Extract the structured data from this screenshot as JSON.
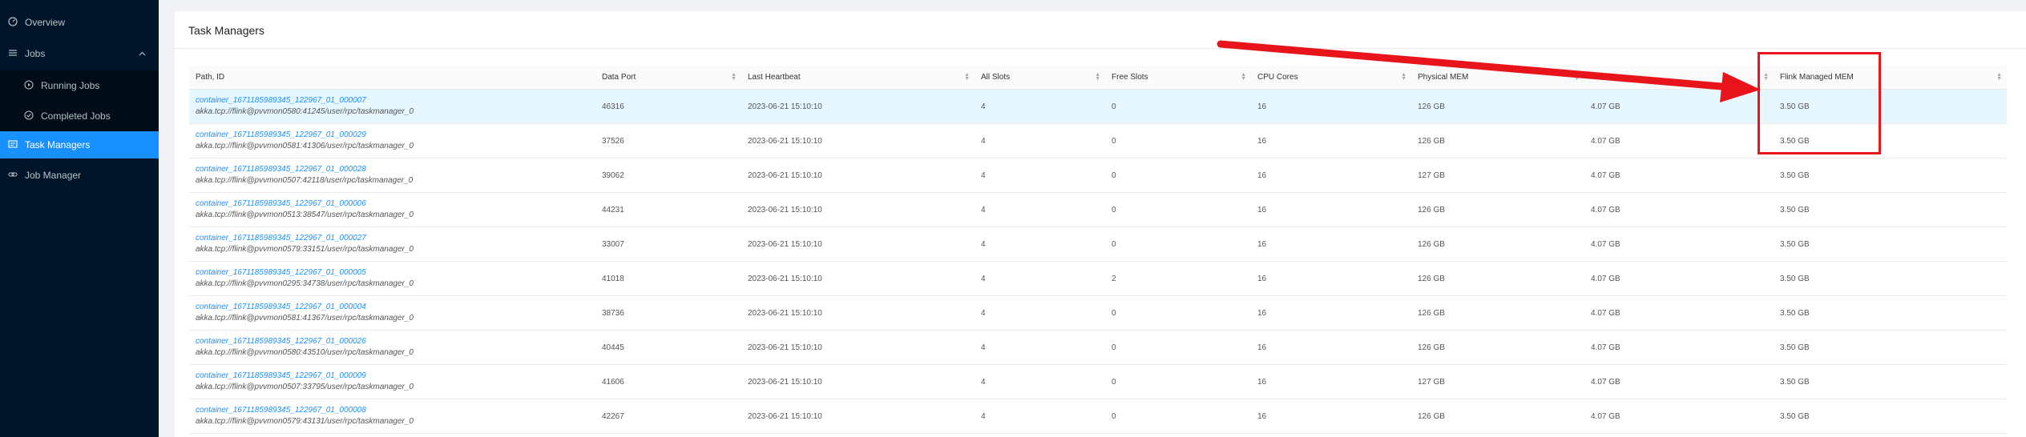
{
  "sidebar": {
    "overview": "Overview",
    "jobs": "Jobs",
    "running_jobs": "Running Jobs",
    "completed_jobs": "Completed Jobs",
    "task_managers": "Task Managers",
    "job_manager": "Job Manager"
  },
  "panel": {
    "title": "Task Managers"
  },
  "table": {
    "headers": [
      "Path, ID",
      "Data Port",
      "Last Heartbeat",
      "All Slots",
      "Free Slots",
      "CPU Cores",
      "Physical MEM",
      "",
      "Flink Managed MEM"
    ],
    "rows": [
      {
        "id": "container_1671185989345_122967_01_000007",
        "path": "akka.tcp://flink@pvvmon0580:41245/user/rpc/taskmanager_0",
        "port": "46316",
        "hb": "2023-06-21 15:10:10",
        "all": "4",
        "free": "0",
        "cores": "16",
        "phys": "126 GB",
        "jvm": "4.07 GB",
        "managed": "3.50 GB"
      },
      {
        "id": "container_1671185989345_122967_01_000029",
        "path": "akka.tcp://flink@pvvmon0581:41306/user/rpc/taskmanager_0",
        "port": "37526",
        "hb": "2023-06-21 15:10:10",
        "all": "4",
        "free": "0",
        "cores": "16",
        "phys": "126 GB",
        "jvm": "4.07 GB",
        "managed": "3.50 GB"
      },
      {
        "id": "container_1671185989345_122967_01_000028",
        "path": "akka.tcp://flink@pvvmon0507:42118/user/rpc/taskmanager_0",
        "port": "39062",
        "hb": "2023-06-21 15:10:10",
        "all": "4",
        "free": "0",
        "cores": "16",
        "phys": "127 GB",
        "jvm": "4.07 GB",
        "managed": "3.50 GB"
      },
      {
        "id": "container_1671185989345_122967_01_000006",
        "path": "akka.tcp://flink@pvvmon0513:38547/user/rpc/taskmanager_0",
        "port": "44231",
        "hb": "2023-06-21 15:10:10",
        "all": "4",
        "free": "0",
        "cores": "16",
        "phys": "126 GB",
        "jvm": "4.07 GB",
        "managed": "3.50 GB"
      },
      {
        "id": "container_1671185989345_122967_01_000027",
        "path": "akka.tcp://flink@pvvmon0579:33151/user/rpc/taskmanager_0",
        "port": "33007",
        "hb": "2023-06-21 15:10:10",
        "all": "4",
        "free": "0",
        "cores": "16",
        "phys": "126 GB",
        "jvm": "4.07 GB",
        "managed": "3.50 GB"
      },
      {
        "id": "container_1671185989345_122967_01_000005",
        "path": "akka.tcp://flink@pvvmon0295:34738/user/rpc/taskmanager_0",
        "port": "41018",
        "hb": "2023-06-21 15:10:10",
        "all": "4",
        "free": "2",
        "cores": "16",
        "phys": "126 GB",
        "jvm": "4.07 GB",
        "managed": "3.50 GB"
      },
      {
        "id": "container_1671185989345_122967_01_000004",
        "path": "akka.tcp://flink@pvvmon0581:41367/user/rpc/taskmanager_0",
        "port": "38736",
        "hb": "2023-06-21 15:10:10",
        "all": "4",
        "free": "0",
        "cores": "16",
        "phys": "126 GB",
        "jvm": "4.07 GB",
        "managed": "3.50 GB"
      },
      {
        "id": "container_1671185989345_122967_01_000026",
        "path": "akka.tcp://flink@pvvmon0580:43510/user/rpc/taskmanager_0",
        "port": "40445",
        "hb": "2023-06-21 15:10:10",
        "all": "4",
        "free": "0",
        "cores": "16",
        "phys": "126 GB",
        "jvm": "4.07 GB",
        "managed": "3.50 GB"
      },
      {
        "id": "container_1671185989345_122967_01_000009",
        "path": "akka.tcp://flink@pvvmon0507:33795/user/rpc/taskmanager_0",
        "port": "41606",
        "hb": "2023-06-21 15:10:10",
        "all": "4",
        "free": "0",
        "cores": "16",
        "phys": "127 GB",
        "jvm": "4.07 GB",
        "managed": "3.50 GB"
      },
      {
        "id": "container_1671185989345_122967_01_000008",
        "path": "akka.tcp://flink@pvvmon0579:43131/user/rpc/taskmanager_0",
        "port": "42267",
        "hb": "2023-06-21 15:10:10",
        "all": "4",
        "free": "0",
        "cores": "16",
        "phys": "126 GB",
        "jvm": "4.07 GB",
        "managed": "3.50 GB"
      }
    ]
  },
  "colors": {
    "sidebar_bg": "#001529",
    "active": "#1890ff",
    "annotation": "#e8141b"
  },
  "icons": [
    "dashboard-icon",
    "bars-icon",
    "chevron-up-icon",
    "play-circle-icon",
    "check-circle-icon",
    "task-manager-icon",
    "job-manager-icon",
    "sort-icon"
  ]
}
